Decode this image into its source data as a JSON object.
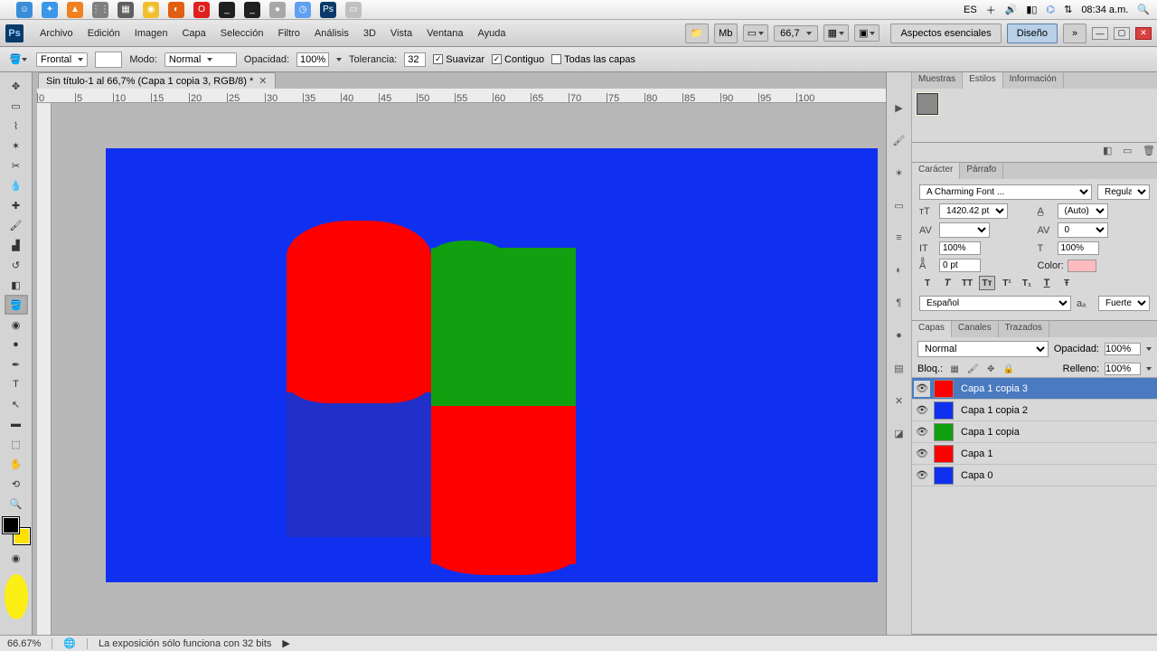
{
  "mac": {
    "language": "ES",
    "time": "08:34 a.m."
  },
  "menu": {
    "items": [
      "Archivo",
      "Edición",
      "Imagen",
      "Capa",
      "Selección",
      "Filtro",
      "Análisis",
      "3D",
      "Vista",
      "Ventana",
      "Ayuda"
    ],
    "zoom": "66,7",
    "workspaces": {
      "essentials": "Aspectos esenciales",
      "design": "Diseño"
    }
  },
  "options": {
    "fill": "Frontal",
    "modo_label": "Modo:",
    "modo": "Normal",
    "opacidad_label": "Opacidad:",
    "opacidad": "100%",
    "tolerancia_label": "Tolerancia:",
    "tolerancia": "32",
    "suavizar": "Suavizar",
    "contiguo": "Contiguo",
    "todas": "Todas las capas"
  },
  "doc": {
    "tab": "Sin título-1 al 66,7% (Capa 1 copia 3, RGB/8) *",
    "ruler": [
      "0",
      "5",
      "10",
      "15",
      "20",
      "25",
      "30",
      "35",
      "40",
      "45",
      "50",
      "55",
      "60",
      "65",
      "70",
      "75",
      "80",
      "85",
      "90",
      "95",
      "100"
    ]
  },
  "panels": {
    "swatches_tabs": [
      "Muestras",
      "Estilos",
      "Información"
    ],
    "char_tabs": [
      "Carácter",
      "Párrafo"
    ],
    "char": {
      "font": "A Charming Font ...",
      "style": "Regular",
      "size": "1420.42 pt",
      "leading": "(Auto)",
      "tracking": "0",
      "scale_h": "100%",
      "scale_v": "100%",
      "baseline": "0 pt",
      "color_label": "Color:",
      "lang": "Español",
      "aa": "Fuerte"
    },
    "layers_tabs": [
      "Capas",
      "Canales",
      "Trazados"
    ],
    "layers": {
      "blend": "Normal",
      "opacity_label": "Opacidad:",
      "opacity": "100%",
      "lock_label": "Bloq.:",
      "fill_label": "Relleno:",
      "fill": "100%",
      "items": [
        {
          "name": "Capa 1 copia 3",
          "selected": true,
          "thumb": "#ff0000"
        },
        {
          "name": "Capa 1 copia 2",
          "selected": false,
          "thumb": "#1030f0"
        },
        {
          "name": "Capa 1 copia",
          "selected": false,
          "thumb": "#10a010"
        },
        {
          "name": "Capa 1",
          "selected": false,
          "thumb": "#ff0000"
        },
        {
          "name": "Capa 0",
          "selected": false,
          "thumb": "#1030f0"
        }
      ]
    }
  },
  "status": {
    "zoom": "66.67%",
    "msg": "La exposición sólo funciona con 32 bits"
  }
}
